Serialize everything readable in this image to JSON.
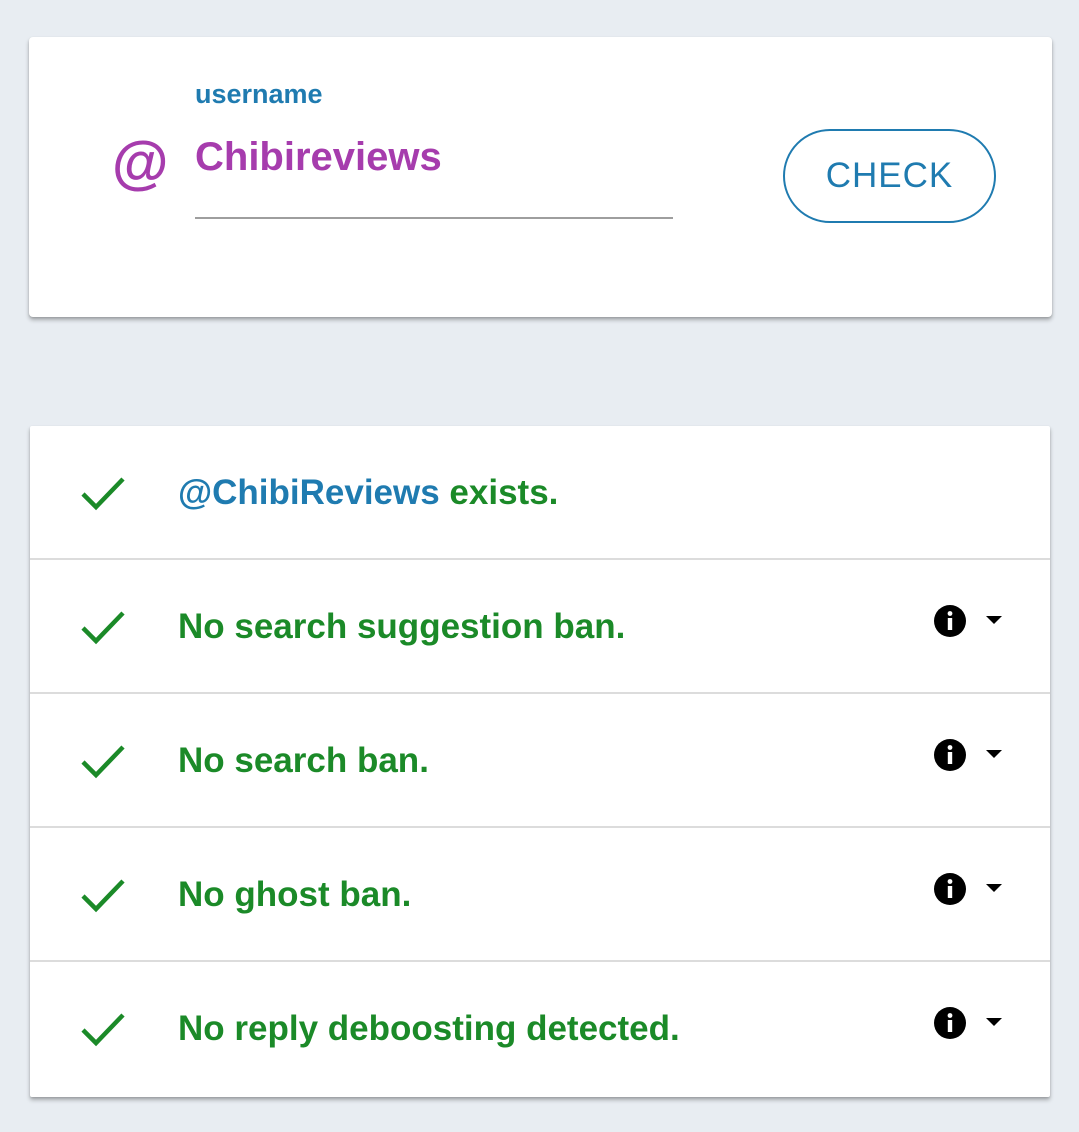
{
  "search": {
    "at_symbol": "@",
    "label": "username",
    "value": "Chibireviews",
    "button_label": "CHECK"
  },
  "results": [
    {
      "handle": "@ChibiReviews",
      "text": " exists.",
      "status": "pass",
      "icon": "check-icon",
      "has_info": false
    },
    {
      "text": "No search suggestion ban.",
      "status": "pass",
      "icon": "check-icon",
      "has_info": true
    },
    {
      "text": "No search ban.",
      "status": "pass",
      "icon": "check-icon",
      "has_info": true
    },
    {
      "text": "No ghost ban.",
      "status": "pass",
      "icon": "check-icon",
      "has_info": true
    },
    {
      "text": "No reply deboosting detected.",
      "status": "pass",
      "icon": "check-icon",
      "has_info": true
    }
  ],
  "colors": {
    "background": "#e8edf2",
    "accent_blue": "#1f7bb0",
    "accent_purple": "#a63cad",
    "success_green": "#1b8a28"
  }
}
